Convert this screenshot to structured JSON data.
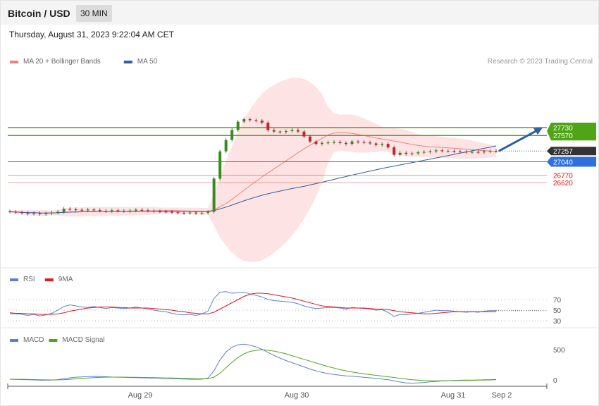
{
  "header": {
    "title": "Bitcoin / USD",
    "timeframe": "30 MIN"
  },
  "datetime": "Thursday, August 31, 2023 9:22:04 AM CET",
  "legend_main": [
    {
      "label": "MA 20 + Bollinger Bands",
      "color": "#f08080"
    },
    {
      "label": "MA 50",
      "color": "#2f5f9e"
    }
  ],
  "legend_rsi": [
    {
      "label": "RSI",
      "color": "#5b7fd6"
    },
    {
      "label": "9MA",
      "color": "#e8141e"
    }
  ],
  "legend_macd": [
    {
      "label": "MACD",
      "color": "#5b7fd6"
    },
    {
      "label": "MACD Signal",
      "color": "#4fa516"
    }
  ],
  "credit": "Research © 2023 Trading Central",
  "chart_data": [
    {
      "type": "candlestick",
      "title": "Bitcoin / USD",
      "x_ticks": [
        "Aug 29",
        "Aug 30",
        "Aug 31",
        "Sep 2"
      ],
      "levels": [
        {
          "value": 27730,
          "label": "27730",
          "kind": "resistance",
          "color": "#4fa516"
        },
        {
          "value": 27570,
          "label": "27570",
          "kind": "resistance",
          "color": "#4fa516"
        },
        {
          "value": 27257,
          "label": "27257",
          "kind": "last",
          "color": "#333333"
        },
        {
          "value": 27040,
          "label": "27040",
          "kind": "pivot",
          "color": "#2f6fe0"
        },
        {
          "value": 26770,
          "label": "26770",
          "kind": "support",
          "color": "#e05050"
        },
        {
          "value": 26620,
          "label": "26620",
          "kind": "support",
          "color": "#e05050"
        }
      ],
      "last_price": 27257,
      "forecast_arrow": {
        "from": 27257,
        "to": 27730,
        "direction": "up"
      },
      "close_series": [
        26030,
        26020,
        26010,
        25990,
        26005,
        25985,
        26000,
        26015,
        26030,
        26090,
        26080,
        26070,
        26060,
        26075,
        26065,
        26050,
        26040,
        26060,
        26050,
        26045,
        26055,
        26070,
        26060,
        26050,
        26040,
        26035,
        26030,
        26020,
        26010,
        26005,
        26015,
        26000,
        26010,
        26030,
        26700,
        27250,
        27480,
        27680,
        27850,
        27900,
        27880,
        27870,
        27830,
        27680,
        27650,
        27640,
        27660,
        27680,
        27650,
        27550,
        27450,
        27400,
        27420,
        27430,
        27440,
        27420,
        27400,
        27450,
        27440,
        27430,
        27410,
        27380,
        27400,
        27330,
        27180,
        27220,
        27200,
        27210,
        27230,
        27240,
        27250,
        27270,
        27260,
        27260,
        27250,
        27245,
        27235,
        27240,
        27230,
        27250,
        27260,
        27257
      ]
    },
    {
      "type": "line",
      "title": "RSI",
      "y_ticks": [
        70,
        50,
        30
      ],
      "ylim": [
        20,
        90
      ],
      "series": [
        {
          "name": "RSI",
          "color": "#5b7fd6",
          "values": [
            43,
            43,
            42,
            40,
            42,
            39,
            41,
            44,
            50,
            57,
            60,
            58,
            56,
            55,
            57,
            55,
            53,
            55,
            54,
            53,
            54,
            56,
            54,
            52,
            50,
            48,
            47,
            44,
            42,
            41,
            42,
            40,
            43,
            48,
            72,
            84,
            85,
            82,
            83,
            84,
            81,
            78,
            75,
            70,
            68,
            67,
            66,
            65,
            62,
            58,
            55,
            53,
            54,
            55,
            55,
            54,
            52,
            55,
            54,
            53,
            52,
            50,
            51,
            46,
            38,
            42,
            41,
            43,
            44,
            46,
            48,
            50,
            49,
            49,
            48,
            47,
            46,
            47,
            46,
            48,
            49,
            49
          ]
        },
        {
          "name": "9MA",
          "color": "#e8141e",
          "values": [
            45,
            44,
            44,
            43,
            43,
            42,
            42,
            42,
            43,
            45,
            48,
            50,
            52,
            54,
            55,
            56,
            56,
            56,
            55,
            55,
            54,
            54,
            54,
            54,
            53,
            52,
            51,
            50,
            48,
            47,
            45,
            44,
            43,
            43,
            46,
            52,
            58,
            64,
            70,
            76,
            80,
            82,
            82,
            81,
            79,
            77,
            75,
            73,
            70,
            67,
            64,
            61,
            58,
            57,
            56,
            55,
            54,
            54,
            54,
            54,
            53,
            52,
            52,
            51,
            49,
            47,
            46,
            45,
            44,
            43,
            43,
            44,
            45,
            46,
            47,
            47,
            47,
            47,
            47,
            47,
            47,
            47
          ]
        }
      ]
    },
    {
      "type": "line",
      "title": "MACD",
      "y_ticks": [
        500,
        0
      ],
      "ylim": [
        -100,
        650
      ],
      "series": [
        {
          "name": "MACD",
          "color": "#5b7fd6",
          "values": [
            10,
            8,
            5,
            2,
            0,
            -5,
            -5,
            -3,
            5,
            20,
            35,
            45,
            50,
            55,
            58,
            57,
            52,
            48,
            45,
            43,
            40,
            38,
            35,
            32,
            30,
            28,
            25,
            22,
            18,
            15,
            12,
            10,
            12,
            30,
            150,
            330,
            460,
            540,
            580,
            590,
            575,
            545,
            505,
            455,
            405,
            360,
            320,
            285,
            250,
            215,
            180,
            150,
            125,
            105,
            90,
            78,
            68,
            60,
            52,
            44,
            35,
            25,
            15,
            2,
            -15,
            -35,
            -50,
            -55,
            -50,
            -42,
            -33,
            -25,
            -18,
            -12,
            -8,
            -5,
            -3,
            -2,
            -1,
            2,
            5,
            8
          ]
        },
        {
          "name": "MACD Signal",
          "color": "#4fa516",
          "values": [
            12,
            11,
            10,
            8,
            6,
            3,
            1,
            0,
            1,
            4,
            10,
            18,
            25,
            32,
            38,
            42,
            45,
            46,
            46,
            45,
            44,
            43,
            41,
            39,
            37,
            35,
            33,
            31,
            28,
            26,
            23,
            21,
            19,
            20,
            45,
            110,
            200,
            290,
            370,
            430,
            470,
            490,
            495,
            490,
            475,
            455,
            430,
            400,
            370,
            340,
            310,
            280,
            250,
            220,
            195,
            170,
            150,
            130,
            115,
            100,
            88,
            76,
            64,
            52,
            40,
            26,
            14,
            4,
            -4,
            -10,
            -13,
            -14,
            -14,
            -13,
            -12,
            -10,
            -8,
            -6,
            -4,
            -2,
            0,
            2
          ]
        }
      ]
    }
  ]
}
